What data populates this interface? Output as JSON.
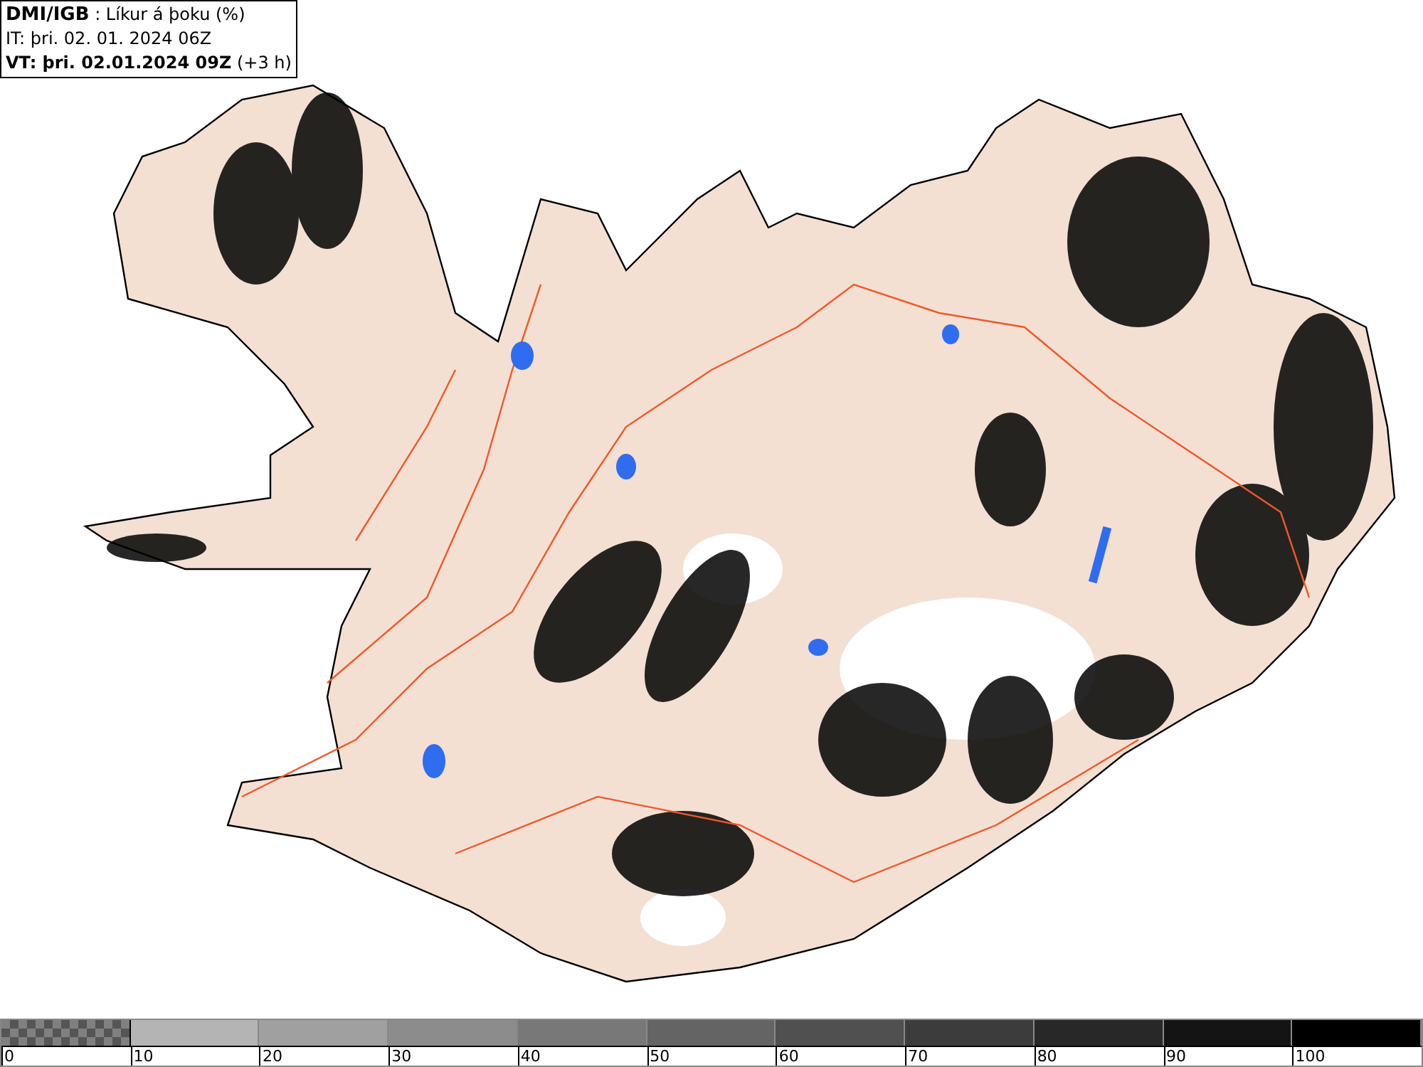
{
  "header": {
    "source": "DMI/IGB",
    "title": ": Líkur á þoku (%)",
    "init_time": "IT: þri. 02. 01. 2024 06Z",
    "valid_time": "VT: þri. 02.01.2024 09Z",
    "offset": "(+3 h)"
  },
  "legend": {
    "bins": [
      {
        "kind": "checker",
        "label": "0",
        "color": "#808080"
      },
      {
        "kind": "solid",
        "label": "10",
        "color": "#b4b4b4"
      },
      {
        "kind": "solid",
        "label": "20",
        "color": "#a0a0a0"
      },
      {
        "kind": "solid",
        "label": "30",
        "color": "#8c8c8c"
      },
      {
        "kind": "solid",
        "label": "40",
        "color": "#787878"
      },
      {
        "kind": "solid",
        "label": "50",
        "color": "#646464"
      },
      {
        "kind": "solid",
        "label": "60",
        "color": "#505050"
      },
      {
        "kind": "solid",
        "label": "70",
        "color": "#3c3c3c"
      },
      {
        "kind": "solid",
        "label": "80",
        "color": "#282828"
      },
      {
        "kind": "solid",
        "label": "90",
        "color": "#141414"
      },
      {
        "kind": "solid",
        "label": "100",
        "color": "#000000"
      }
    ]
  }
}
